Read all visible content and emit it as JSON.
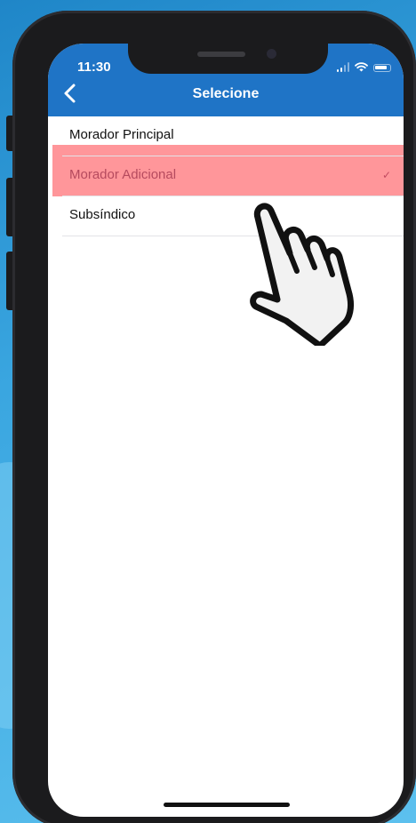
{
  "status_bar": {
    "time": "11:30"
  },
  "nav": {
    "title": "Selecione",
    "back_icon": "chevron-left-icon"
  },
  "options": [
    {
      "label": "Morador Principal",
      "selected": false
    },
    {
      "label": "Morador Adicional",
      "selected": true
    },
    {
      "label": "Subsíndico",
      "selected": false
    }
  ],
  "selected_mark": "✓",
  "colors": {
    "header": "#1f74c6",
    "highlight": "#ff787d",
    "selected_text": "#b54a5e"
  },
  "overlay": {
    "pointer_icon": "tap-hand-icon"
  }
}
